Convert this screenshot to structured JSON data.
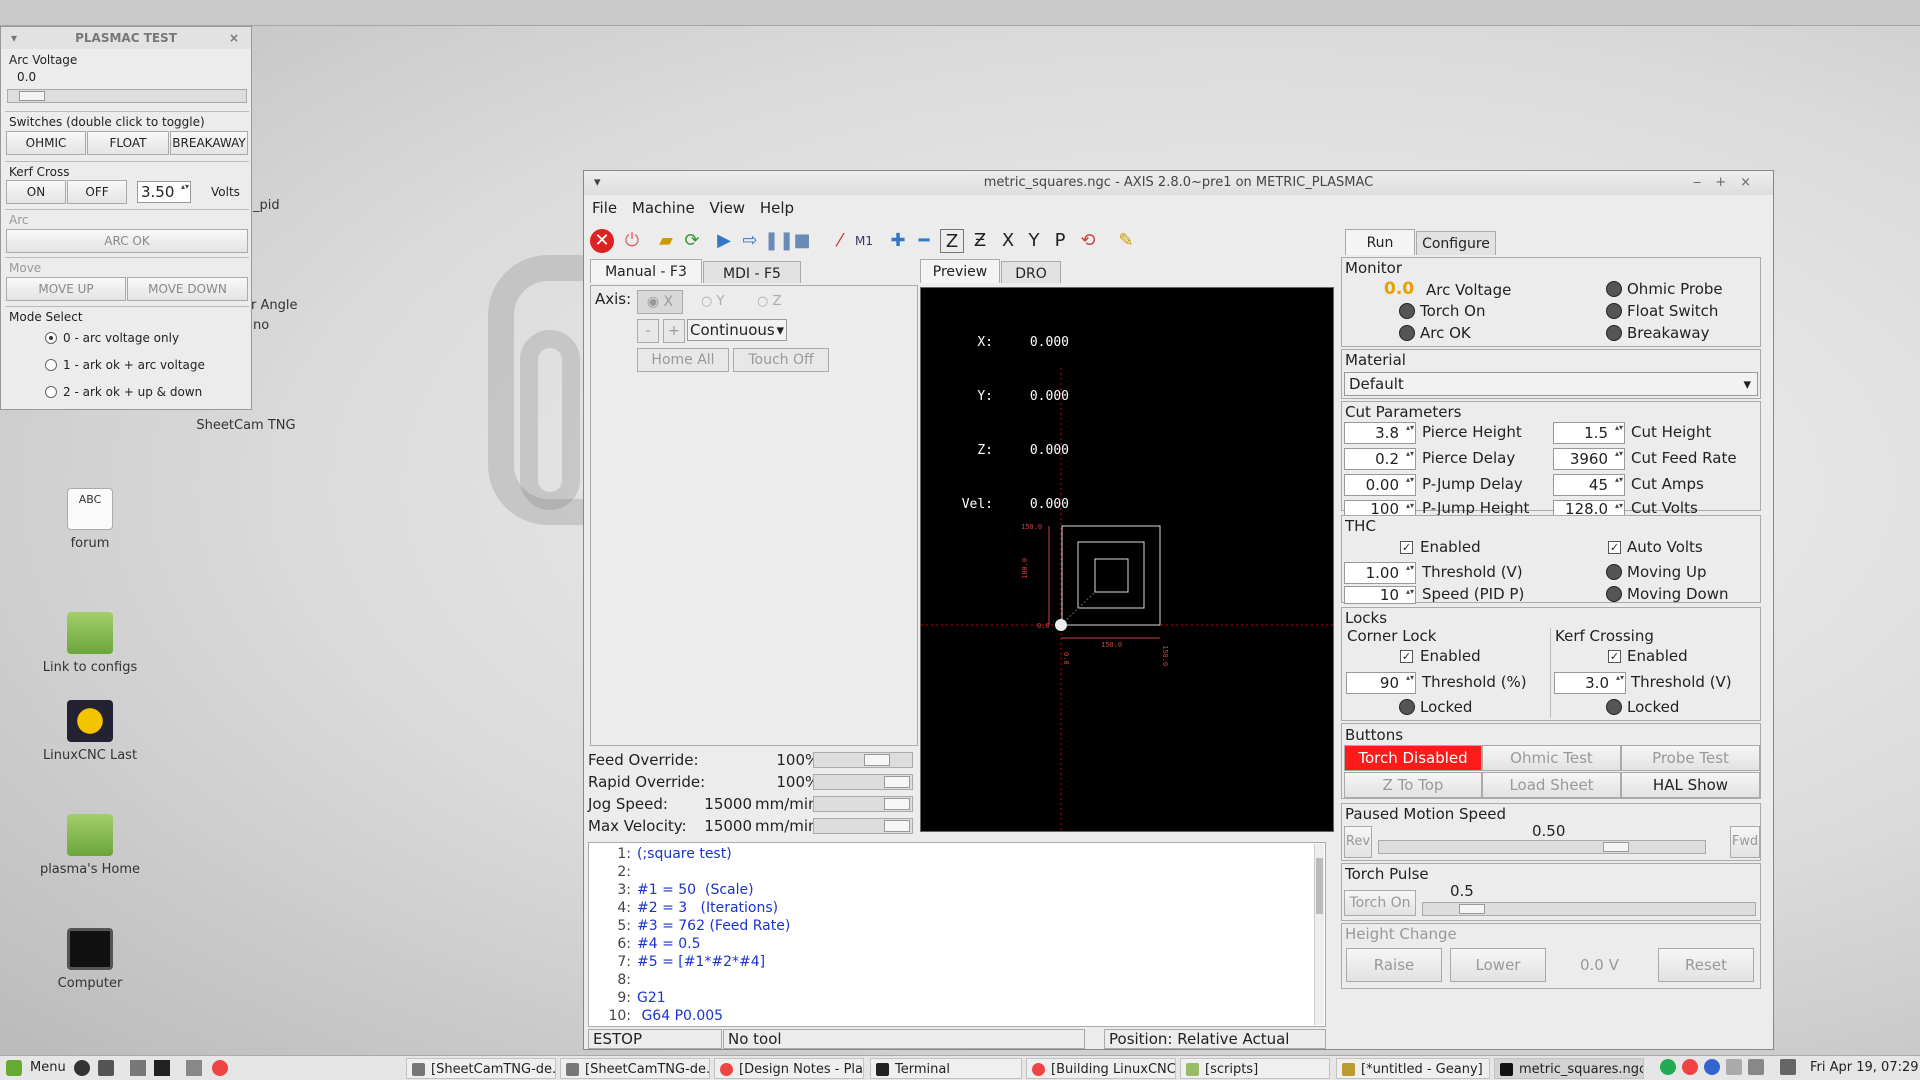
{
  "desktop": {
    "icons": [
      {
        "label": "forum",
        "icon": "text-file-icon"
      },
      {
        "label": "Link to configs",
        "icon": "folder-link-icon"
      },
      {
        "label": "LinuxCNC Last",
        "icon": "linuxcnc-icon"
      },
      {
        "label": "plasma's Home",
        "icon": "home-folder-icon"
      },
      {
        "label": "Computer",
        "icon": "monitor-icon"
      },
      {
        "label": "SheetCam TNG",
        "icon": "app-icon"
      },
      {
        "label": "_pid",
        "icon": "app-icon"
      },
      {
        "label": "r Angle",
        "icon": "app-icon"
      },
      {
        "label": "no",
        "icon": "app-icon"
      }
    ]
  },
  "plasmac_test": {
    "title": "PLASMAC TEST",
    "arc_voltage_label": "Arc Voltage",
    "arc_voltage_value": "0.0",
    "arc_voltage_slider": 0.05,
    "switches_label": "Switches (double click to toggle)",
    "ohmic": "OHMIC",
    "float": "FLOAT",
    "breakaway": "BREAKAWAY",
    "kerf_label": "Kerf Cross",
    "kerf_on": "ON",
    "kerf_off": "OFF",
    "kerf_value": "3.50",
    "kerf_unit": "Volts",
    "arc_label": "Arc",
    "arc_ok": "ARC OK",
    "move_label": "Move",
    "move_up": "MOVE UP",
    "move_down": "MOVE DOWN",
    "mode_label": "Mode Select",
    "modes": [
      "0 - arc voltage only",
      "1 - ark ok + arc voltage",
      "2 - ark ok + up & down"
    ],
    "mode_selected": 0
  },
  "axis": {
    "title": "metric_squares.ngc - AXIS 2.8.0~pre1 on METRIC_PLASMAC",
    "menu": [
      "File",
      "Machine",
      "View",
      "Help"
    ],
    "tabs": [
      "Manual - F3",
      "MDI - F5"
    ],
    "preview_tabs": [
      "Preview",
      "DRO"
    ],
    "axis_label": "Axis:",
    "axes": [
      "X",
      "Y",
      "Z"
    ],
    "jog_minus": "-",
    "jog_plus": "+",
    "jog_mode": "Continuous",
    "home_all": "Home All",
    "touch_off": "Touch Off",
    "dro": [
      {
        "k": "X:",
        "v": "0.000"
      },
      {
        "k": "Y:",
        "v": "0.000"
      },
      {
        "k": "Z:",
        "v": "0.000"
      },
      {
        "k": "Vel:",
        "v": "0.000"
      }
    ],
    "preview_dims": {
      "y_top": "150.0",
      "y_mid": "100.0",
      "y_zero": "0.0",
      "x_mid": "150.0",
      "x_zero": "0.0",
      "x_right": "150.0"
    },
    "overrides": [
      {
        "label": "Feed Override:",
        "value": "100",
        "unit": "%",
        "frac": 0.72
      },
      {
        "label": "Rapid Override:",
        "value": "100",
        "unit": "%",
        "frac": 1.0
      },
      {
        "label": "Jog Speed:",
        "value": "15000",
        "unit": "mm/min",
        "frac": 1.0
      },
      {
        "label": "Max Velocity:",
        "value": "15000",
        "unit": "mm/min",
        "frac": 1.0
      }
    ],
    "code": [
      {
        "n": "1:",
        "t": "(;square test)"
      },
      {
        "n": "2:",
        "t": ""
      },
      {
        "n": "3:",
        "t": "#1 = 50  (Scale)"
      },
      {
        "n": "4:",
        "t": "#2 = 3   (Iterations)"
      },
      {
        "n": "5:",
        "t": "#3 = 762 (Feed Rate)"
      },
      {
        "n": "6:",
        "t": "#4 = 0.5"
      },
      {
        "n": "7:",
        "t": "#5 = [#1*#2*#4]"
      },
      {
        "n": "8:",
        "t": ""
      },
      {
        "n": "9:",
        "t": "G21"
      },
      {
        "n": "10:",
        "t": " G64 P0.005"
      }
    ],
    "status": {
      "estop": "ESTOP",
      "tool": "No tool",
      "position": "Position: Relative Actual"
    }
  },
  "plasmac": {
    "tabs": [
      "Run",
      "Configure"
    ],
    "monitor": {
      "label": "Monitor",
      "arc_value": "0.0",
      "arc_label": "Arc Voltage",
      "torch_on": "Torch On",
      "arc_ok": "Arc OK",
      "ohmic_probe": "Ohmic Probe",
      "float_switch": "Float Switch",
      "breakaway": "Breakaway"
    },
    "material": {
      "label": "Material",
      "value": "Default"
    },
    "cut": {
      "label": "Cut Parameters",
      "rows": [
        {
          "lv": "3.8",
          "ll": "Pierce Height",
          "rv": "1.5",
          "rl": "Cut Height"
        },
        {
          "lv": "0.2",
          "ll": "Pierce Delay",
          "rv": "3960",
          "rl": "Cut Feed Rate"
        },
        {
          "lv": "0.00",
          "ll": "P-Jump Delay",
          "rv": "45",
          "rl": "Cut Amps"
        },
        {
          "lv": "100",
          "ll": "P-Jump Height",
          "rv": "128.0",
          "rl": "Cut Volts"
        }
      ]
    },
    "thc": {
      "label": "THC",
      "enabled": "Enabled",
      "auto_volts": "Auto Volts",
      "threshold_value": "1.00",
      "threshold_label": "Threshold (V)",
      "speed_value": "10",
      "speed_label": "Speed (PID P)",
      "moving_up": "Moving Up",
      "moving_down": "Moving Down"
    },
    "locks": {
      "label": "Locks",
      "corner": "Corner Lock",
      "kerf": "Kerf Crossing",
      "enabled": "Enabled",
      "corner_value": "90",
      "corner_th": "Threshold (%)",
      "kerf_value": "3.0",
      "kerf_th": "Threshold (V)",
      "locked": "Locked"
    },
    "buttons": {
      "label": "Buttons",
      "torch_disabled": "Torch Disabled",
      "ohmic_test": "Ohmic Test",
      "probe_test": "Probe Test",
      "z_to_top": "Z To Top",
      "load_sheet": "Load Sheet",
      "hal_show": "HAL Show",
      "torch_color": "#ff1a1a"
    },
    "paused": {
      "label": "Paused Motion Speed",
      "value": "0.50",
      "rev": "Rev",
      "fwd": "Fwd",
      "frac": 0.75
    },
    "pulse": {
      "label": "Torch Pulse",
      "value": "0.5",
      "torch_on": "Torch On",
      "frac": 0.12
    },
    "height": {
      "label": "Height Change",
      "raise": "Raise",
      "lower": "Lower",
      "value": "0.0 V",
      "reset": "Reset"
    }
  },
  "taskbar": {
    "menu": "Menu",
    "items": [
      "[SheetCamTNG-de...",
      "[SheetCamTNG-de...",
      "[Design Notes - Pla...",
      "Terminal",
      "[Building LinuxCNC...",
      "[scripts]",
      "[*untitled - Geany]",
      "metric_squares.ngc"
    ],
    "active": 7,
    "clock": "Fri Apr 19, 07:29"
  }
}
